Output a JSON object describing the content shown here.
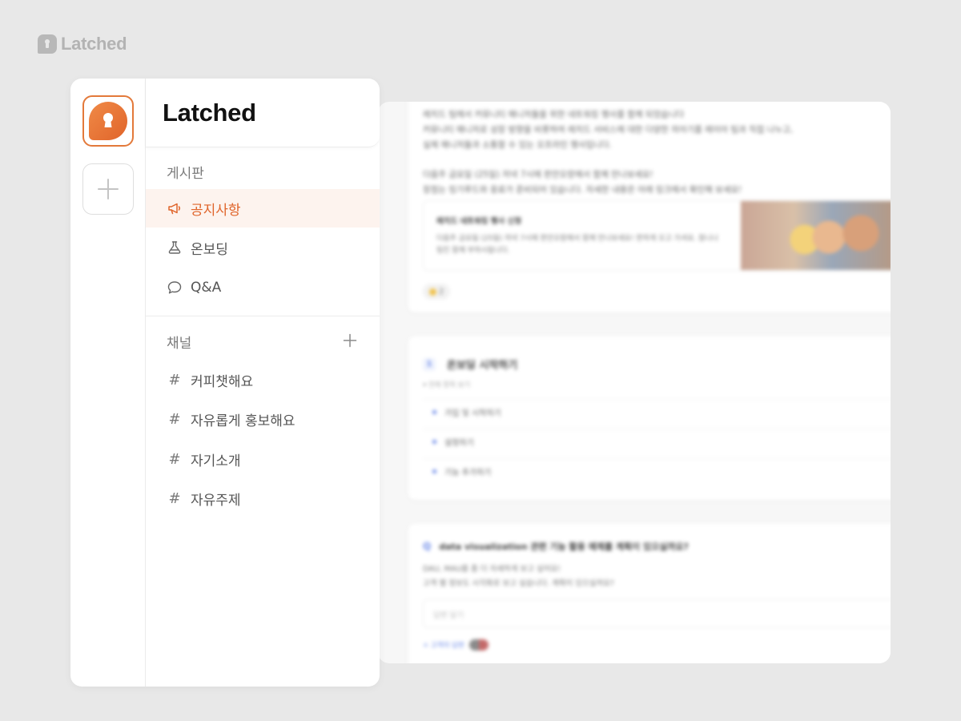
{
  "brand": {
    "name": "Latched"
  },
  "sidebar": {
    "title": "Latched",
    "board_label": "게시판",
    "board_items": [
      {
        "label": "공지사항",
        "icon": "megaphone-icon",
        "active": true
      },
      {
        "label": "온보딩",
        "icon": "flask-icon",
        "active": false
      },
      {
        "label": "Q&A",
        "icon": "chat-bubble-icon",
        "active": false
      }
    ],
    "channel_label": "채널",
    "channels": [
      {
        "label": "커피챗해요"
      },
      {
        "label": "자유롭게 홍보해요"
      },
      {
        "label": "자기소개"
      },
      {
        "label": "자유주제"
      }
    ],
    "hash_symbol": "#"
  },
  "content": {
    "announcement": {
      "lines": [
        "레치드 팀에서 커뮤니티 매니저들을 위한 네트워킹 행사를 함께 되었습니다",
        "커뮤니티 매니저로 성장 방향을 비롯하여 레치드 서비스에 대한 다양한 의아기를 레이아 팀과 직접 나누고,",
        "실제 매니저들과 소통할 수 있는 오프라인 행사입니다.",
        "다음주 금요일 (25일) 저녁 7시에 판안오랑에서 함께 만나보세요!",
        "장점는 링기루드와 응료가 준비되어 있습니다. 자세한 내용은 아래 링크에서 확인해 보세요!"
      ],
      "embed_title": "레치드 네트워킹 행사 신청",
      "embed_desc": "다음주 금요일 (25일) 저녁 7시에 판안오랑에서 함께 만나보세요! 판하게 오고 가셔요. 참니나 링킨 함께 부하시됩니다.",
      "reaction_count": "2"
    },
    "onboarding": {
      "number": "1",
      "title": "온보딩 시작하기",
      "subtitle": "▾ 전체 항목 보기",
      "steps": [
        "가입 및 시작하기",
        "설정하기",
        "기능 추가하기"
      ]
    },
    "qa": {
      "title": "data visualization 관련 기능 활용 예제를 계획이 있으실까요?",
      "line1": "DAU, MAU를 좀 더 자세하게 보고 싶어요!",
      "line2": "고객 별 정보도 시각화로 보고 싶습니다. 계획이 있으실까요?",
      "answer_placeholder": "답변 달기",
      "footer": "+ 고객의 답변"
    }
  }
}
